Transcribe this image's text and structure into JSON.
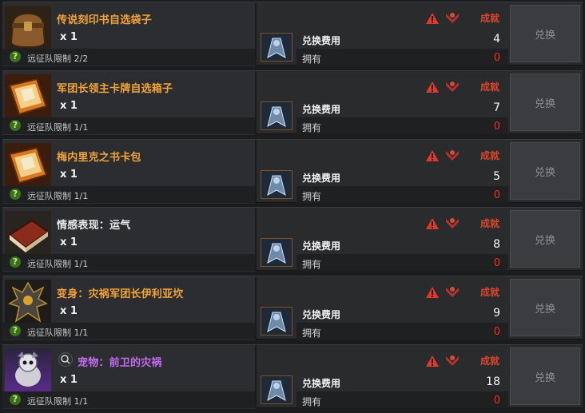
{
  "common": {
    "qty": "x 1",
    "cost_label": "兑换费用",
    "own_label": "拥有",
    "own_value": "0",
    "achievement": "成就",
    "exchange": "兑换",
    "help": "?"
  },
  "items": [
    {
      "name": "传说刻印书自选袋子",
      "name_color": "orange",
      "limit": "远征队限制 2/2",
      "cost": "4",
      "icon": "bag-icon"
    },
    {
      "name": "军团长领主卡牌自选箱子",
      "name_color": "orange",
      "limit": "远征队限制 1/1",
      "cost": "7",
      "icon": "card-book-icon"
    },
    {
      "name": "梅内里克之书卡包",
      "name_color": "orange",
      "limit": "远征队限制 1/1",
      "cost": "5",
      "icon": "card-book-icon"
    },
    {
      "name": "情感表现：运气",
      "name_color": "white",
      "limit": "远征队限制 1/1",
      "cost": "8",
      "icon": "book-icon"
    },
    {
      "name": "变身：灾祸军团长伊利亚坎",
      "name_color": "orange",
      "limit": "远征队限制 1/1",
      "cost": "9",
      "icon": "demon-icon"
    },
    {
      "name": "宠物：前卫的灾祸",
      "name_color": "purple",
      "limit": "远征队限制 1/1",
      "cost": "18",
      "icon": "pet-icon"
    }
  ],
  "colors": {
    "orange": "#f2a33a",
    "purple": "#c56df0",
    "red": "#ff2a1a"
  }
}
